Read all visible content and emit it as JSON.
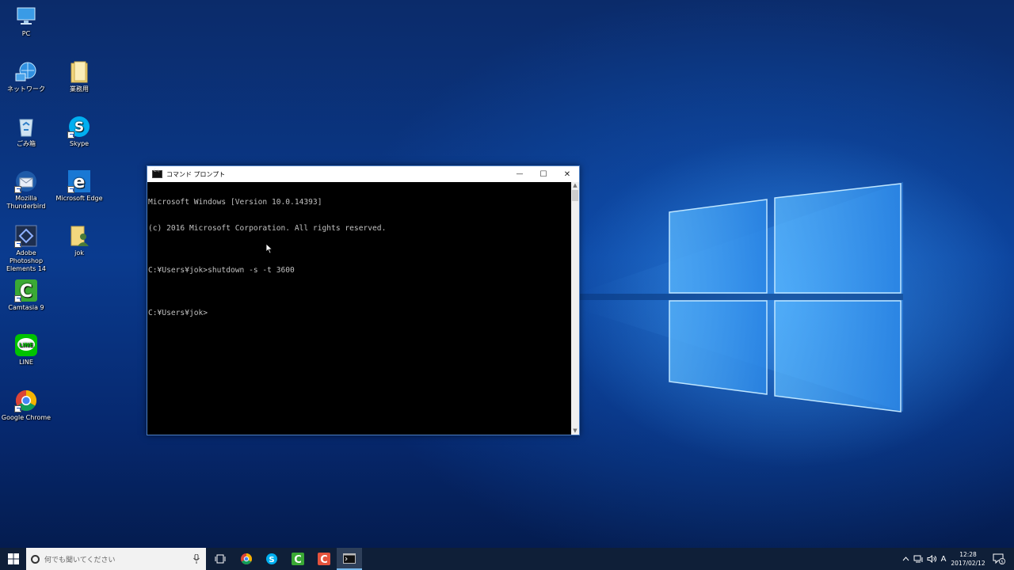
{
  "desktop": {
    "icons": [
      {
        "label": "PC"
      },
      {
        "label": "ネットワーク"
      },
      {
        "label": "業務用"
      },
      {
        "label": "ごみ箱"
      },
      {
        "label": "Skype"
      },
      {
        "label": "Mozilla Thunderbird"
      },
      {
        "label": "Microsoft Edge"
      },
      {
        "label": "Adobe Photoshop Elements 14"
      },
      {
        "label": "jok"
      },
      {
        "label": "Camtasia 9"
      },
      {
        "label": "LINE"
      },
      {
        "label": "Google Chrome"
      }
    ]
  },
  "cmd": {
    "title": "コマンド プロンプト",
    "lines": [
      "Microsoft Windows [Version 10.0.14393]",
      "(c) 2016 Microsoft Corporation. All rights reserved.",
      "",
      "C:¥Users¥jok>shutdown -s -t 3600",
      "",
      "C:¥Users¥jok>"
    ],
    "minimize": "—",
    "maximize": "☐",
    "close": "✕"
  },
  "taskbar": {
    "search_placeholder": "何でも聞いてください",
    "ime": "A",
    "clock": {
      "time": "12:28",
      "date": "2017/02/12"
    },
    "notification_count": "5"
  },
  "colors": {
    "taskbar": "#0f1f38",
    "console_bg": "#000000",
    "console_text": "#c0c0c0",
    "window_border": "#4c7fc4",
    "accent": "#76b9ed"
  }
}
